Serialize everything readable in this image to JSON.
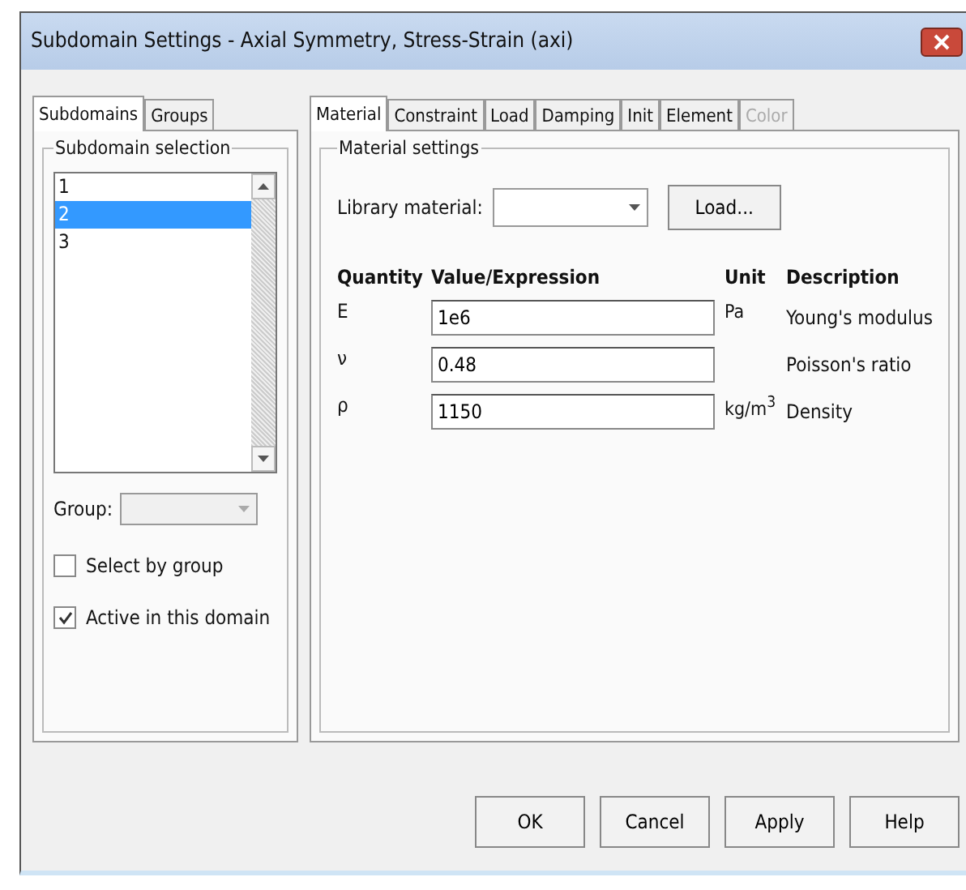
{
  "window": {
    "title": "Subdomain Settings - Axial Symmetry, Stress-Strain (axi)"
  },
  "left_tabs": [
    {
      "label": "Subdomains",
      "selected": true
    },
    {
      "label": "Groups",
      "selected": false
    }
  ],
  "subdomain_selection": {
    "title": "Subdomain selection",
    "items": [
      {
        "label": "1",
        "selected": false
      },
      {
        "label": "2",
        "selected": true
      },
      {
        "label": "3",
        "selected": false
      }
    ],
    "group_label": "Group:",
    "select_by_group": {
      "label": "Select by group",
      "checked": false
    },
    "active_in_domain": {
      "label": "Active in this domain",
      "checked": true
    }
  },
  "right_tabs": [
    {
      "label": "Material",
      "selected": true,
      "disabled": false
    },
    {
      "label": "Constraint",
      "selected": false,
      "disabled": false
    },
    {
      "label": "Load",
      "selected": false,
      "disabled": false
    },
    {
      "label": "Damping",
      "selected": false,
      "disabled": false
    },
    {
      "label": "Init",
      "selected": false,
      "disabled": false
    },
    {
      "label": "Element",
      "selected": false,
      "disabled": false
    },
    {
      "label": "Color",
      "selected": false,
      "disabled": true
    }
  ],
  "material_settings": {
    "title": "Material settings",
    "library_label": "Library material:",
    "load_button": "Load...",
    "columns": [
      "Quantity",
      "Value/Expression",
      "Unit",
      "Description"
    ],
    "rows": [
      {
        "quantity": "E",
        "value": "1e6",
        "unit": "Pa",
        "description": "Young's modulus"
      },
      {
        "quantity": "ν",
        "value": "0.48",
        "unit": "",
        "description": "Poisson's ratio"
      },
      {
        "quantity": "ρ",
        "value": "1150",
        "unit": "kg/m$^{3}$",
        "description": "Density"
      }
    ]
  },
  "buttons": [
    "OK",
    "Cancel",
    "Apply",
    "Help"
  ]
}
